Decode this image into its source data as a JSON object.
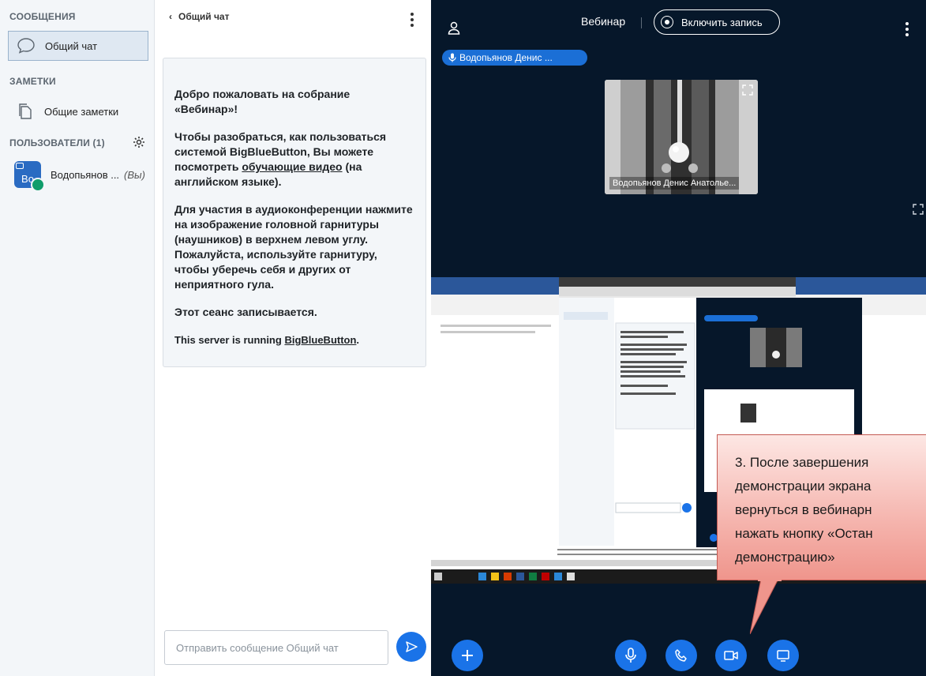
{
  "sidebar": {
    "messages_title": "СООБЩЕНИЯ",
    "public_chat_label": "Общий чат",
    "notes_title": "ЗАМЕТКИ",
    "shared_notes_label": "Общие заметки",
    "users_title": "ПОЛЬЗОВАТЕЛИ (1)",
    "user": {
      "initials": "Bo",
      "name": "Водопьянов ...",
      "you_tag": "(Вы)"
    }
  },
  "chat": {
    "title": "Общий чат",
    "welcome": {
      "p1_pre": "Добро пожаловать на собрание «",
      "p1_bold": "Вебинар",
      "p1_post": "»!",
      "p2_pre": "Чтобы разобраться, как пользоваться системой BigBlueButton, Вы можете посмотреть ",
      "p2_link": "обучающие видео",
      "p2_post": " (на английском языке).",
      "p3_pre": "Для участия в аудиоконференции нажмите на изображение головной гарнитуры (наушников) в верхнем левом углу. ",
      "p3_bold": "Пожалуйста, используйте гарнитуру, чтобы уберечь себя и других от неприятного гула.",
      "p4": "Этот сеанс записывается.",
      "p5_pre": "This server is running ",
      "p5_link": "BigBlueButton",
      "p5_post": "."
    },
    "input_placeholder": "Отправить сообщение Общий чат"
  },
  "stage": {
    "meeting_title": "Вебинар",
    "record_label": "Включить запись",
    "talking_indicator": "Водопьянов Денис ...",
    "video_label": "Водопьянов Денис Анатолье...",
    "callout_text": "3. После завершения\nдемонстрации экрана\nвернуться в вебинарн\nнажать кнопку «Остан\nдемонстрацию»"
  },
  "colors": {
    "accent": "#1a73e8",
    "stage_bg": "#06172a",
    "mic_green": "#0f9d6b",
    "callout": "#f5b4ad"
  },
  "icons": [
    "chat-bubble-icon",
    "notes-icon",
    "gear-icon",
    "user-icon",
    "kebab-icon",
    "mic-icon",
    "expand-icon",
    "plus-icon",
    "phone-icon",
    "camera-icon",
    "screen-share-icon",
    "send-icon",
    "back-chevron-icon"
  ]
}
